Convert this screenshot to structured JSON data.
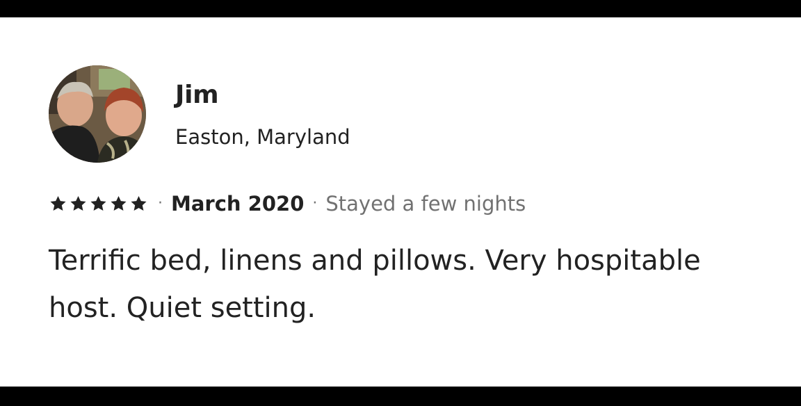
{
  "reviewer": {
    "name": "Jim",
    "location": "Easton, Maryland",
    "avatar_icon": "reviewer-photo"
  },
  "review": {
    "rating": 5,
    "rating_max": 5,
    "star_icon": "star-icon",
    "star_color": "#222222",
    "separator": "·",
    "date": "March 2020",
    "stay_length": "Stayed a few nights",
    "text": "Terrific bed, linens and pillows. Very hospitable host. Quiet setting."
  },
  "colors": {
    "primary_text": "#222222",
    "secondary_text": "#717171",
    "background": "#ffffff",
    "frame": "#000000"
  }
}
